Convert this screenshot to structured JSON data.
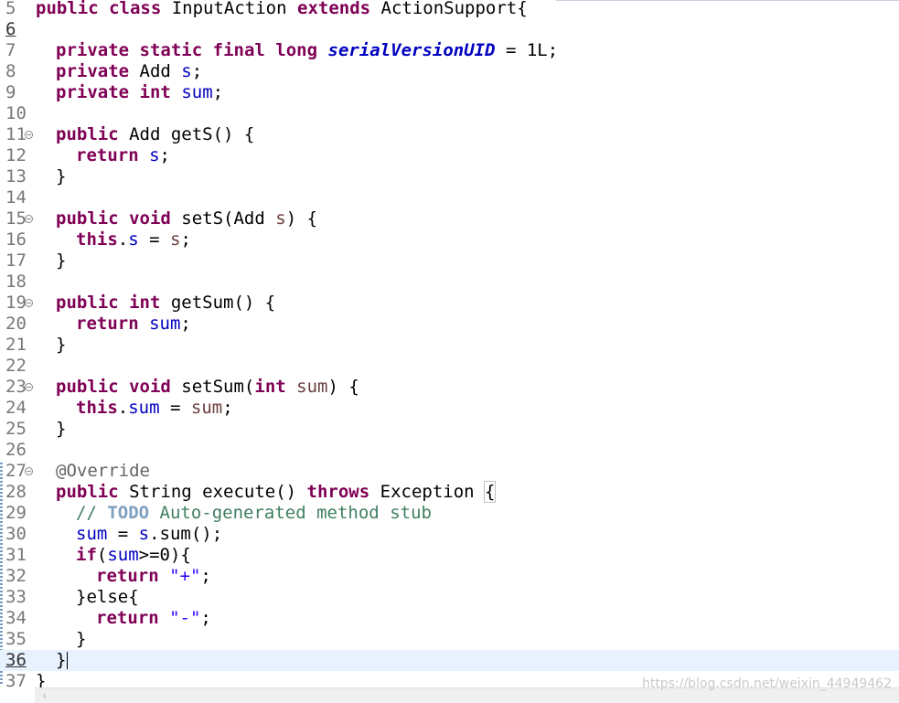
{
  "editor": {
    "current_line": "36",
    "lines": [
      {
        "n": "5",
        "fold": false
      },
      {
        "n": "6",
        "fold": false
      },
      {
        "n": "7",
        "fold": false
      },
      {
        "n": "8",
        "fold": false
      },
      {
        "n": "9",
        "fold": false
      },
      {
        "n": "10",
        "fold": false
      },
      {
        "n": "11",
        "fold": true
      },
      {
        "n": "12",
        "fold": false
      },
      {
        "n": "13",
        "fold": false
      },
      {
        "n": "14",
        "fold": false
      },
      {
        "n": "15",
        "fold": true
      },
      {
        "n": "16",
        "fold": false
      },
      {
        "n": "17",
        "fold": false
      },
      {
        "n": "18",
        "fold": false
      },
      {
        "n": "19",
        "fold": true
      },
      {
        "n": "20",
        "fold": false
      },
      {
        "n": "21",
        "fold": false
      },
      {
        "n": "22",
        "fold": false
      },
      {
        "n": "23",
        "fold": true
      },
      {
        "n": "24",
        "fold": false
      },
      {
        "n": "25",
        "fold": false
      },
      {
        "n": "26",
        "fold": false
      },
      {
        "n": "27",
        "fold": true
      },
      {
        "n": "28",
        "fold": false
      },
      {
        "n": "29",
        "fold": false
      },
      {
        "n": "30",
        "fold": false
      },
      {
        "n": "31",
        "fold": false
      },
      {
        "n": "32",
        "fold": false
      },
      {
        "n": "33",
        "fold": false
      },
      {
        "n": "34",
        "fold": false
      },
      {
        "n": "35",
        "fold": false
      },
      {
        "n": "36",
        "fold": false
      },
      {
        "n": "37",
        "fold": false
      }
    ],
    "code": {
      "l5": [
        "public",
        " ",
        "class",
        " InputAction ",
        "extends",
        " ActionSupport{"
      ],
      "l7": [
        "private",
        " ",
        "static",
        " ",
        "final",
        " ",
        "long",
        " ",
        "serialVersionUID",
        " = 1L;"
      ],
      "l8": [
        "private",
        " Add ",
        "s",
        ";"
      ],
      "l9": [
        "private",
        " ",
        "int",
        " ",
        "sum",
        ";"
      ],
      "l11": [
        "public",
        " Add getS() {"
      ],
      "l12": [
        "return",
        " ",
        "s",
        ";"
      ],
      "l13": [
        "}"
      ],
      "l15": [
        "public",
        " ",
        "void",
        " setS(Add ",
        "s",
        ") {"
      ],
      "l16": [
        "this",
        ".",
        "s",
        " = ",
        "s",
        ";"
      ],
      "l17": [
        "}"
      ],
      "l19": [
        "public",
        " ",
        "int",
        " getSum() {"
      ],
      "l20": [
        "return",
        " ",
        "sum",
        ";"
      ],
      "l21": [
        "}"
      ],
      "l23": [
        "public",
        " ",
        "void",
        " setSum(",
        "int",
        " ",
        "sum",
        ") {"
      ],
      "l24": [
        "this",
        ".",
        "sum",
        " = ",
        "sum",
        ";"
      ],
      "l25": [
        "}"
      ],
      "l27": [
        "@Override"
      ],
      "l28": [
        "public",
        " String execute() ",
        "throws",
        " Exception ",
        "{"
      ],
      "l29": [
        "// ",
        "TODO",
        " Auto-generated method stub"
      ],
      "l30": [
        "sum",
        " = ",
        "s",
        ".sum();"
      ],
      "l31": [
        "if",
        "(",
        "sum",
        ">=0){"
      ],
      "l32": [
        "return",
        " ",
        "\"+\"",
        ";"
      ],
      "l33": [
        "}else{"
      ],
      "l34": [
        "return",
        " ",
        "\"-\"",
        ";"
      ],
      "l35": [
        "}"
      ],
      "l36": [
        "}"
      ],
      "l37": [
        "}"
      ]
    }
  },
  "watermark": "https://blog.csdn.net/weixin_44949462",
  "colors": {
    "keyword": "#7f0055",
    "field": "#0000c0",
    "parameter": "#6a3e3e",
    "comment": "#3f7f5f",
    "todo": "#7f9fbf",
    "string": "#2a00ff",
    "annotation": "#646464",
    "current_line_bg": "#e8f2fe"
  }
}
